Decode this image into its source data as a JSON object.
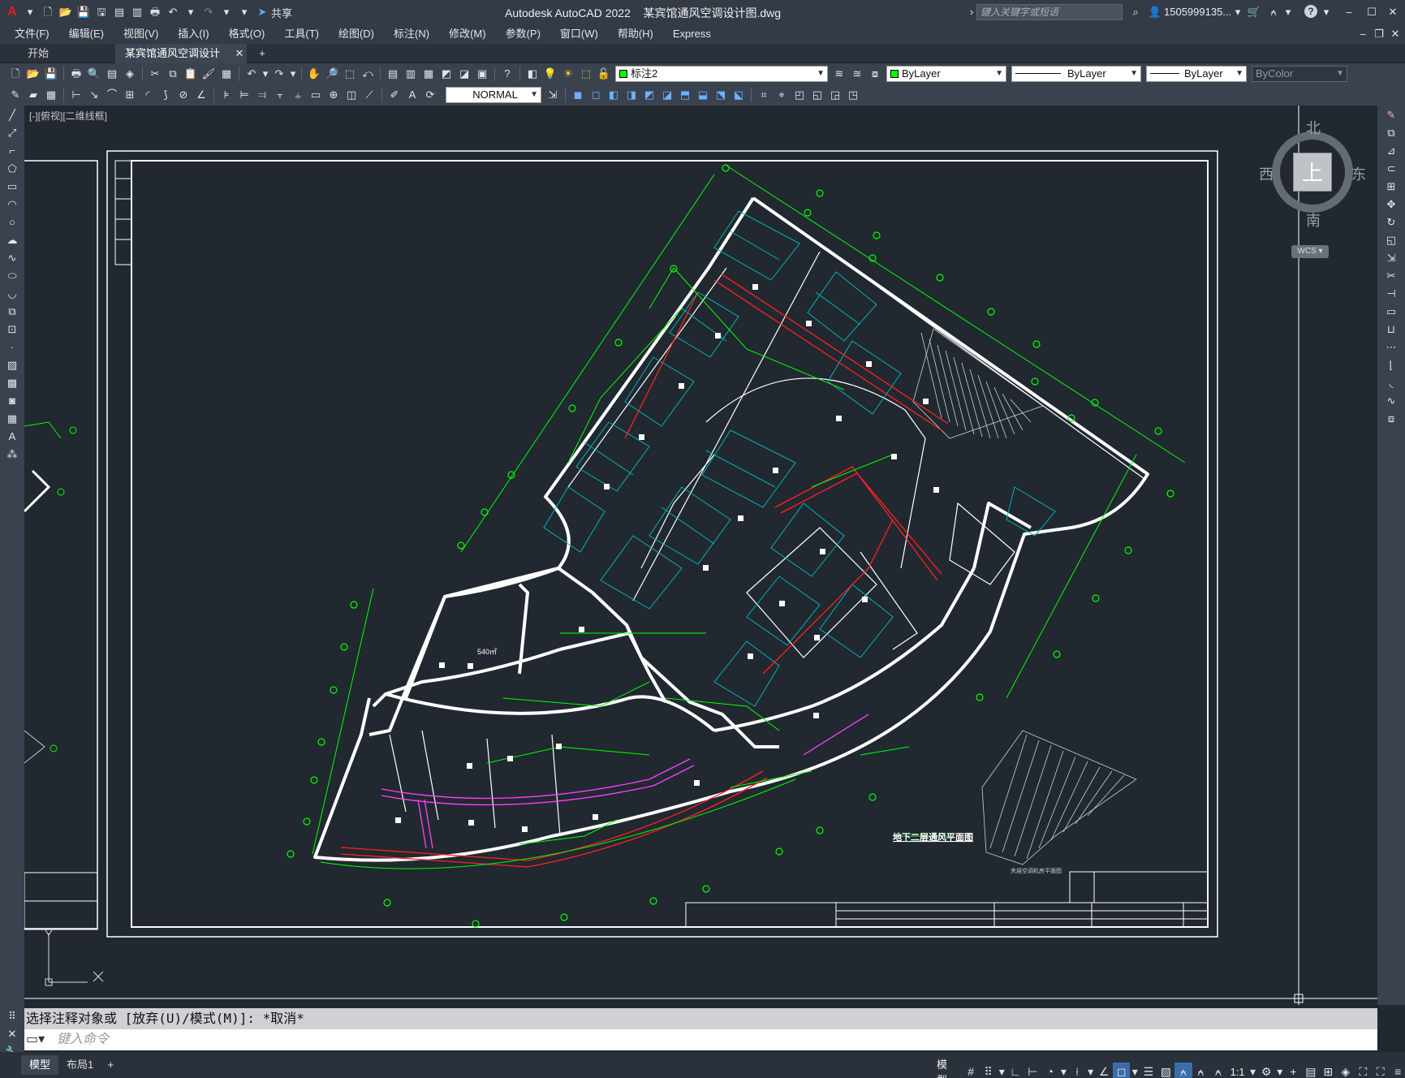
{
  "app": {
    "title": "Autodesk AutoCAD 2022",
    "file": "某宾馆通风空调设计图.dwg",
    "share": "共享",
    "search_placeholder": "键入关键字或短语",
    "user": "1505999135...",
    "help": "?"
  },
  "menu": [
    "文件(F)",
    "编辑(E)",
    "视图(V)",
    "插入(I)",
    "格式(O)",
    "工具(T)",
    "绘图(D)",
    "标注(N)",
    "修改(M)",
    "参数(P)",
    "窗口(W)",
    "帮助(H)",
    "Express"
  ],
  "tabs": [
    {
      "label": "开始"
    },
    {
      "label": "某宾馆通风空调设计图*"
    }
  ],
  "toolbar": {
    "layer": "标注2",
    "color": "ByLayer",
    "linetype": "ByLayer",
    "lineweight": "ByLayer",
    "plotstyle": "ByColor",
    "textstyle": "NORMAL"
  },
  "viewport": {
    "label": "[-][俯视][二维线框]"
  },
  "viewcube": {
    "north": "北",
    "south": "南",
    "east": "东",
    "west": "西",
    "top": "上",
    "wcs": "WCS"
  },
  "drawing": {
    "title": "地下二层通风平面图",
    "area": "540㎡",
    "note": "夹层空调机房平面图"
  },
  "command": {
    "history": "选择注释对象或 [放弃(U)/模式(M)]: *取消*",
    "placeholder": "键入命令"
  },
  "layout_tabs": [
    "模型",
    "布局1"
  ],
  "status": {
    "model": "模型",
    "scale": "1:1"
  },
  "colors": {
    "wall": "#ffffff",
    "dim": "#00ff00",
    "duct": "#ff2020",
    "cyan": "#00bcbc",
    "magenta": "#ff40ff",
    "bg": "#212830"
  }
}
